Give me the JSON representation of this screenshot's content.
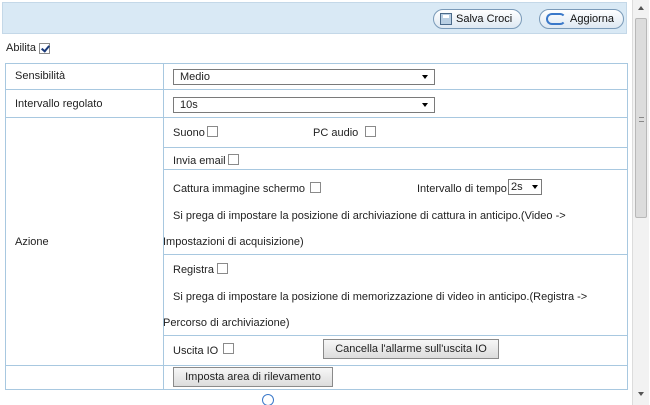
{
  "toolbar": {
    "save_label": "Salva Croci",
    "refresh_label": "Aggiorna"
  },
  "enable": {
    "label": "Abilita",
    "checked": true
  },
  "rows": {
    "sensitivity": {
      "label": "Sensibilità",
      "value": "Medio"
    },
    "interval": {
      "label": "Intervallo regolato",
      "value": "10s"
    },
    "action": {
      "label": "Azione",
      "sound_label": "Suono",
      "pc_audio_label": "PC audio",
      "email_label": "Invia email",
      "snapshot_label": "Cattura immagine schermo",
      "time_interval_label": "Intervallo di tempo",
      "time_interval_value": "2s",
      "snapshot_note_line1": "Si prega di impostare la posizione di archiviazione di cattura in anticipo.(Video ->",
      "snapshot_note_line2": "Impostazioni di acquisizione)",
      "record_label": "Registra",
      "record_note_line1": "Si prega di impostare la posizione di memorizzazione di video in anticipo.(Registra ->",
      "record_note_line2": "Percorso di archiviazione)",
      "io_out_label": "Uscita IO",
      "clear_alarm_label": "Cancella l'allarme sull'uscita IO"
    },
    "detection_area_label": "Imposta area di rilevamento"
  },
  "icons": {
    "save": "save-disk-icon",
    "refresh": "refresh-icon",
    "dropdown": "chevron-down-icon"
  },
  "colors": {
    "toolbar_bg": "#d9e9f5",
    "border": "#a8c8e0"
  }
}
